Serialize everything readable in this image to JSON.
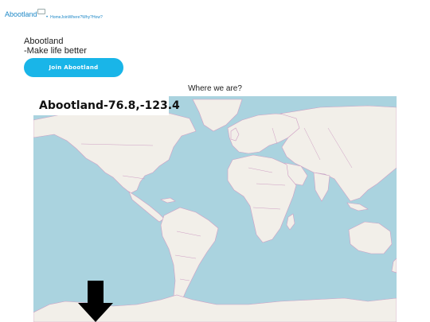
{
  "nav": {
    "brand": "Abootland",
    "links": [
      "Home",
      "Join",
      "Where?",
      "Why?",
      "How?"
    ]
  },
  "hero": {
    "title": "Abootland",
    "tagline": "-Make life better",
    "join_button": "Join Abootland"
  },
  "map": {
    "heading": "Where we are?",
    "coordinate_label": "Abootland-76.8,-123.4",
    "marker": "down-arrow-icon",
    "colors": {
      "ocean": "#aad3df",
      "land": "#f2efe9",
      "border": "#cf9fc4",
      "accent": "#19b5e8"
    }
  }
}
